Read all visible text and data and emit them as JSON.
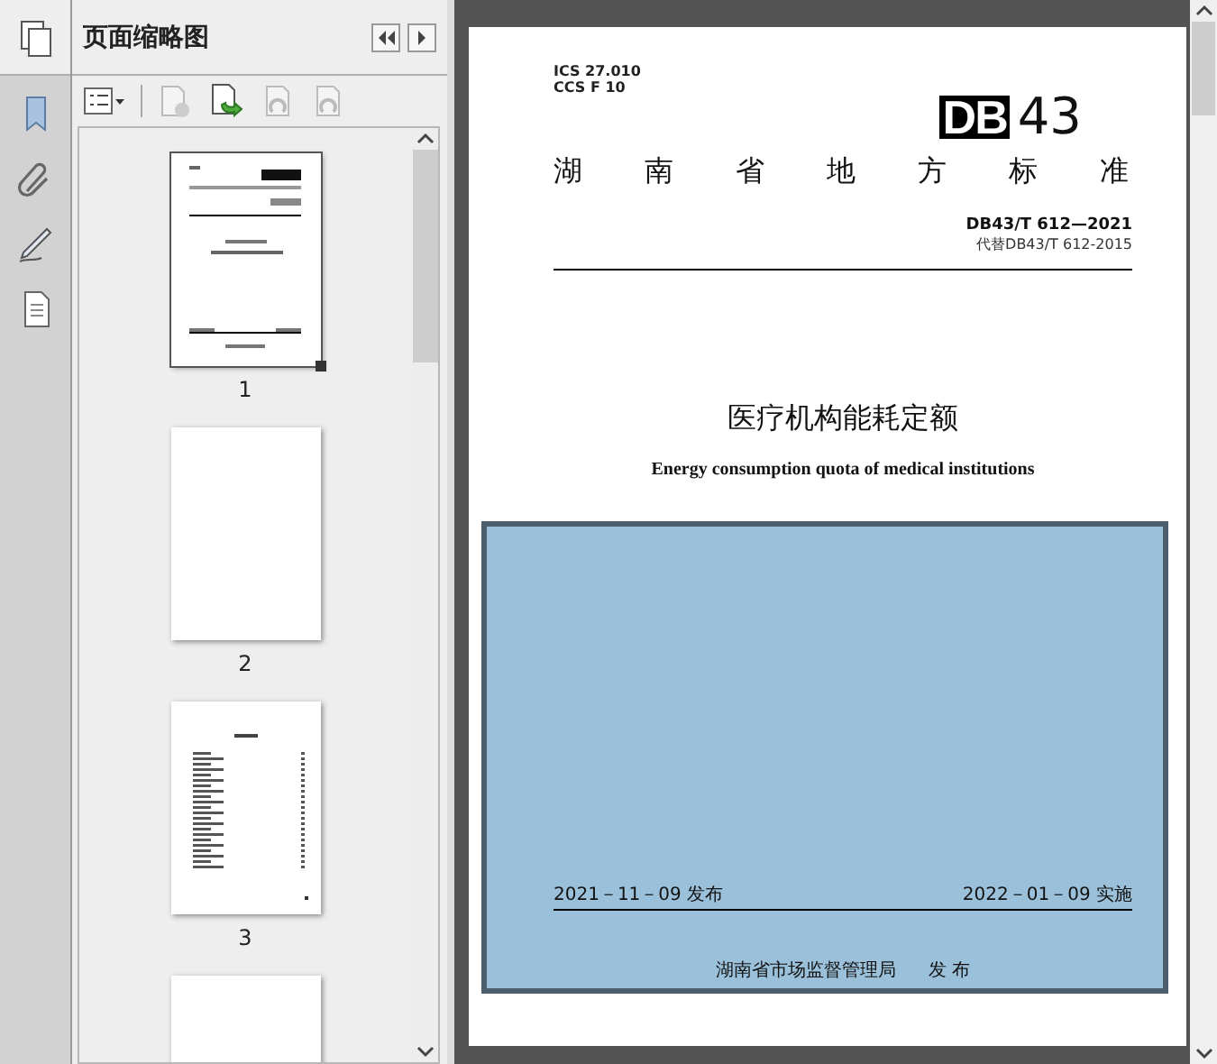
{
  "panel": {
    "title": "页面缩略图"
  },
  "thumbnails": [
    {
      "kind": "cover",
      "label": "1",
      "selected": true
    },
    {
      "kind": "blank",
      "label": "2",
      "selected": false
    },
    {
      "kind": "toc",
      "label": "3",
      "selected": false
    },
    {
      "kind": "blank",
      "selected": false
    }
  ],
  "document": {
    "ics": "ICS 27.010",
    "ccs": "CCS F 10",
    "logo_mark": "DB",
    "logo_number": "43",
    "category": "湖南省地方标准",
    "standard_number": "DB43/T 612—2021",
    "replaces": "代替DB43/T 612-2015",
    "title_cn": "医疗机构能耗定额",
    "title_en": "Energy consumption quota of medical institutions",
    "issue_date": "2021－11－09 发布",
    "effective_date": "2022－01－09 实施",
    "issuer": "湖南省市场监督管理局",
    "issue_word": "发 布",
    "highlighted": true
  }
}
